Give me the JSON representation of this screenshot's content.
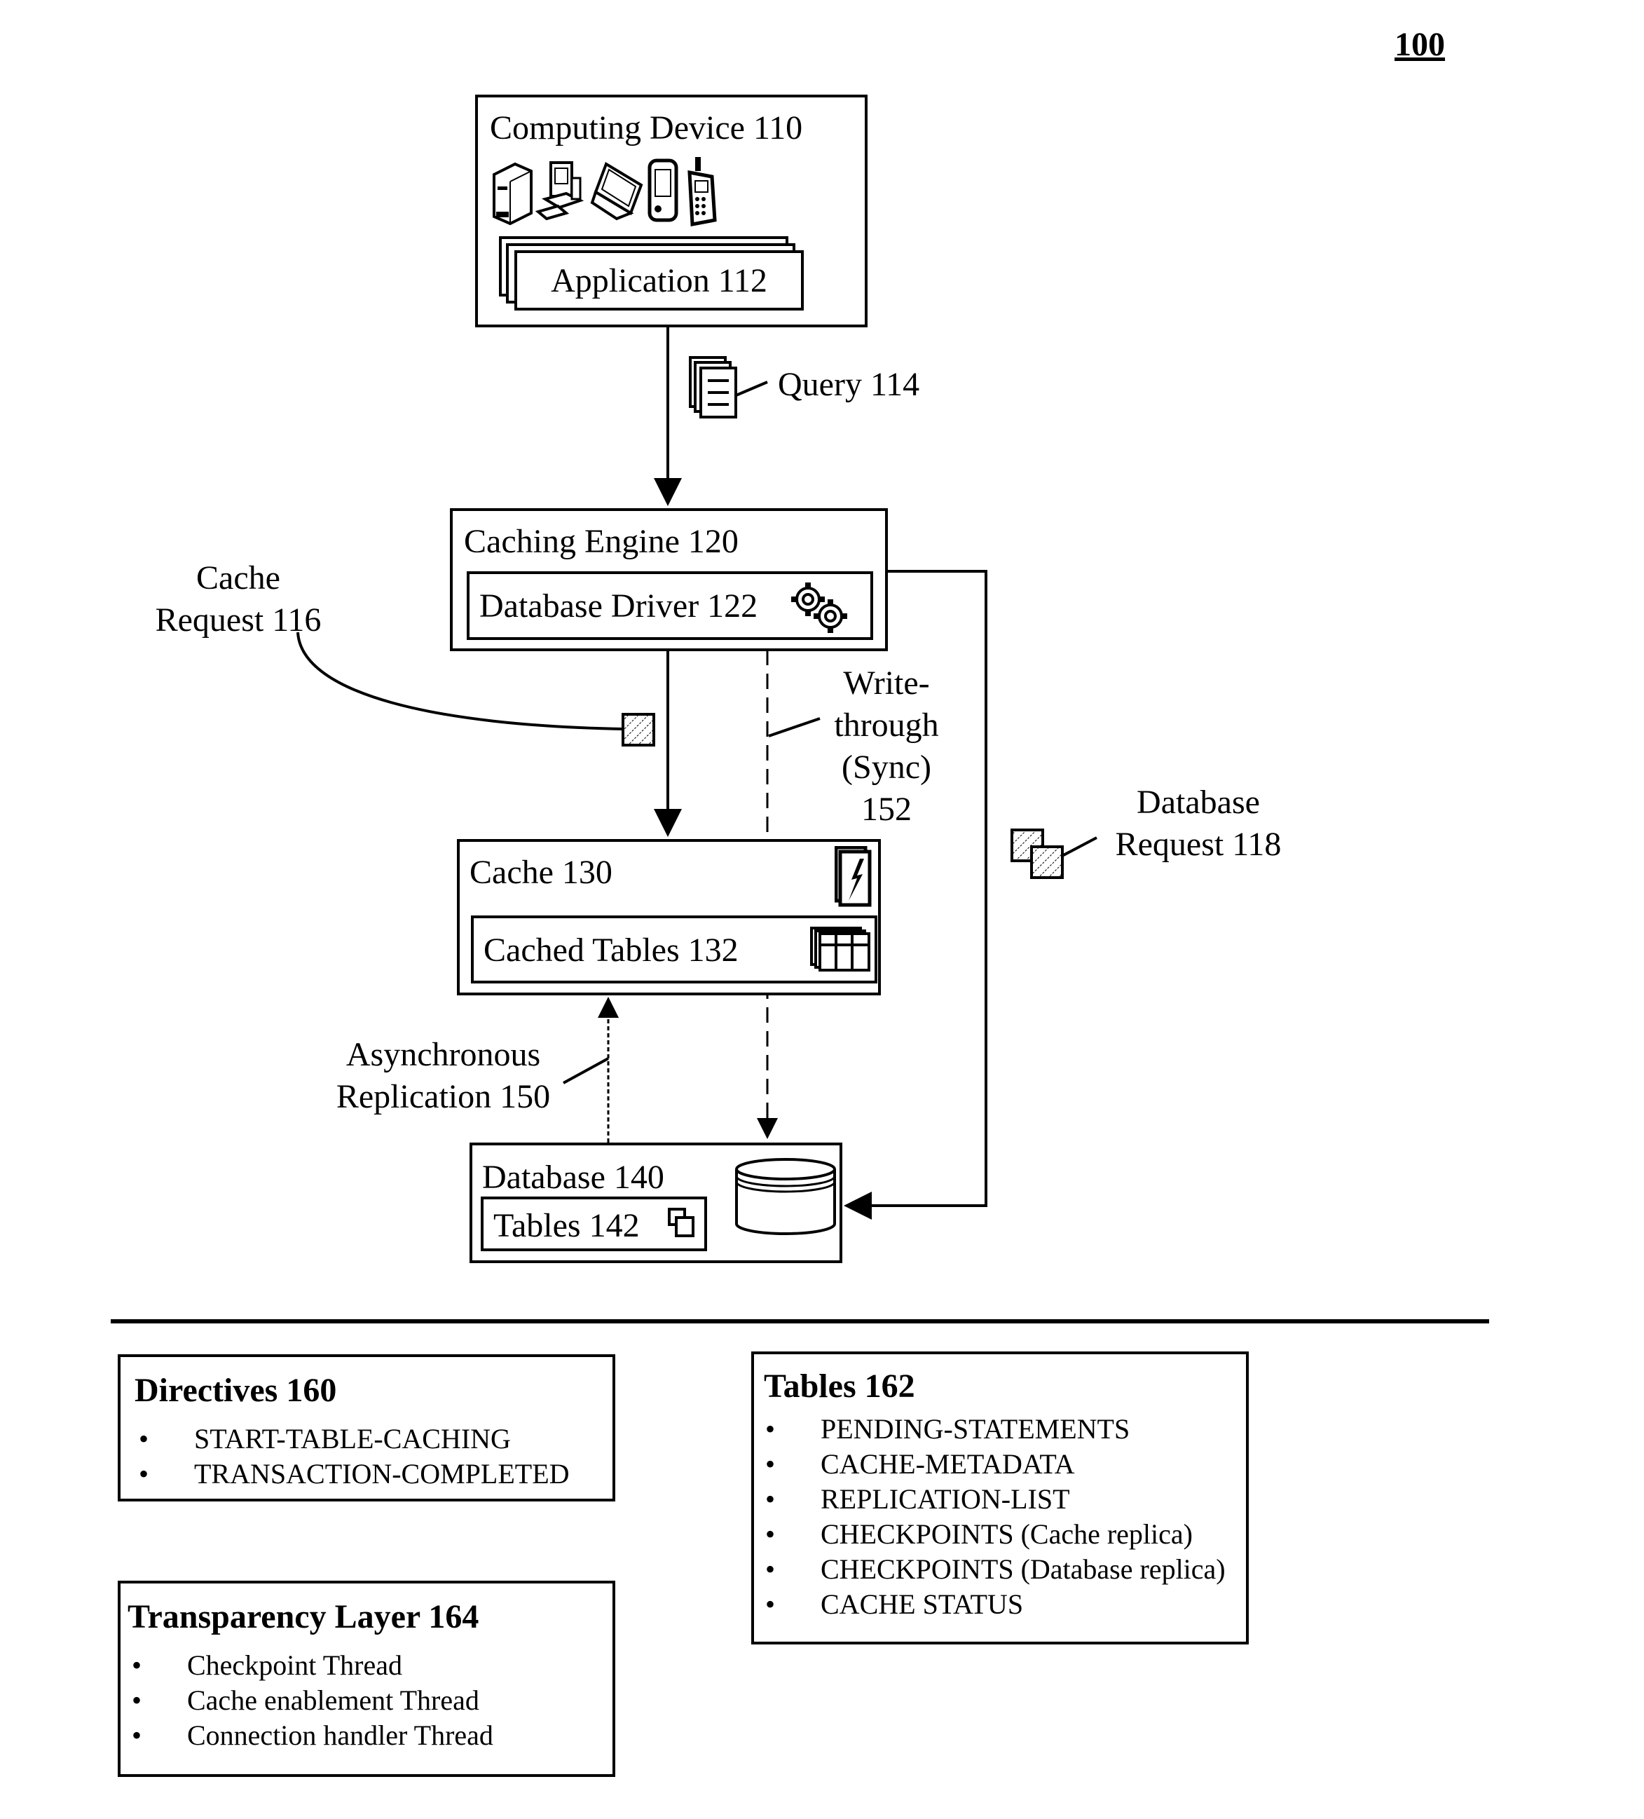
{
  "figure_number": "100",
  "nodes": {
    "computing_device": {
      "label": "Computing Device 110",
      "icons": [
        "server-tower-icon",
        "desktop-computer-icon",
        "laptop-icon",
        "pda-icon",
        "mobile-phone-icon"
      ]
    },
    "application": {
      "label": "Application 112"
    },
    "caching_engine": {
      "label": "Caching Engine 120"
    },
    "database_driver": {
      "label": "Database Driver 122",
      "icon": "gears-icon"
    },
    "cache": {
      "label": "Cache 130",
      "icon": "lightning-document-icon"
    },
    "cached_tables": {
      "label": "Cached Tables 132",
      "icon": "stacked-table-icon"
    },
    "database": {
      "label": "Database 140",
      "icon": "database-cylinder-icon"
    },
    "tables_142": {
      "label": "Tables 142",
      "icon": "copy-icon"
    }
  },
  "edges": {
    "query": {
      "label": "Query 114",
      "icon": "documents-stack-icon"
    },
    "cache_request": {
      "label_line1": "Cache",
      "label_line2": "Request 116",
      "icon": "hatched-packet-icon"
    },
    "database_request": {
      "label_line1": "Database",
      "label_line2": "Request 118",
      "icon": "hatched-packets-icon"
    },
    "write_through": {
      "label_line1": "Write-",
      "label_line2": "through",
      "label_line3": "(Sync)",
      "label_line4": "152"
    },
    "async_replication": {
      "label_line1": "Asynchronous",
      "label_line2": "Replication 150"
    }
  },
  "legends": {
    "directives": {
      "title": "Directives 160",
      "items": [
        "START-TABLE-CACHING",
        "TRANSACTION-COMPLETED"
      ]
    },
    "tables": {
      "title": "Tables 162",
      "items": [
        "PENDING-STATEMENTS",
        "CACHE-METADATA",
        "REPLICATION-LIST",
        "CHECKPOINTS (Cache replica)",
        "CHECKPOINTS (Database replica)",
        "CACHE STATUS"
      ]
    },
    "transparency_layer": {
      "title": "Transparency Layer 164",
      "items": [
        "Checkpoint Thread",
        "Cache enablement Thread",
        "Connection handler Thread"
      ]
    }
  }
}
